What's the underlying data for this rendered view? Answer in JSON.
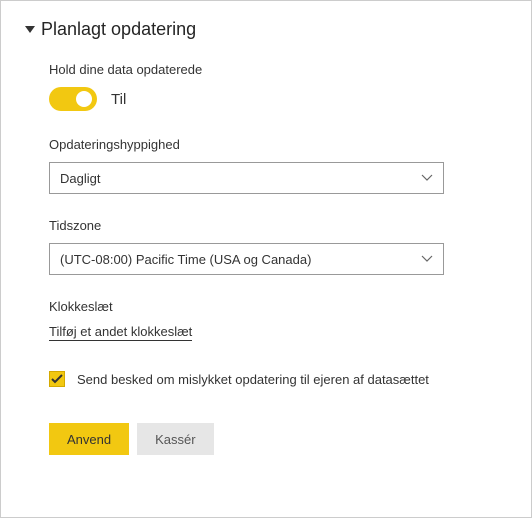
{
  "section": {
    "title": "Planlagt opdatering"
  },
  "keepData": {
    "label": "Hold dine data opdaterede",
    "toggleState": "Til"
  },
  "frequency": {
    "label": "Opdateringshyppighed",
    "value": "Dagligt"
  },
  "timezone": {
    "label": "Tidszone",
    "value": "(UTC-08:00) Pacific Time (USA og Canada)"
  },
  "time": {
    "label": "Klokkeslæt",
    "addLink": "Tilføj et andet klokkeslæt"
  },
  "notification": {
    "label": "Send besked om mislykket opdatering til ejeren af datasættet"
  },
  "buttons": {
    "apply": "Anvend",
    "discard": "Kassér"
  }
}
